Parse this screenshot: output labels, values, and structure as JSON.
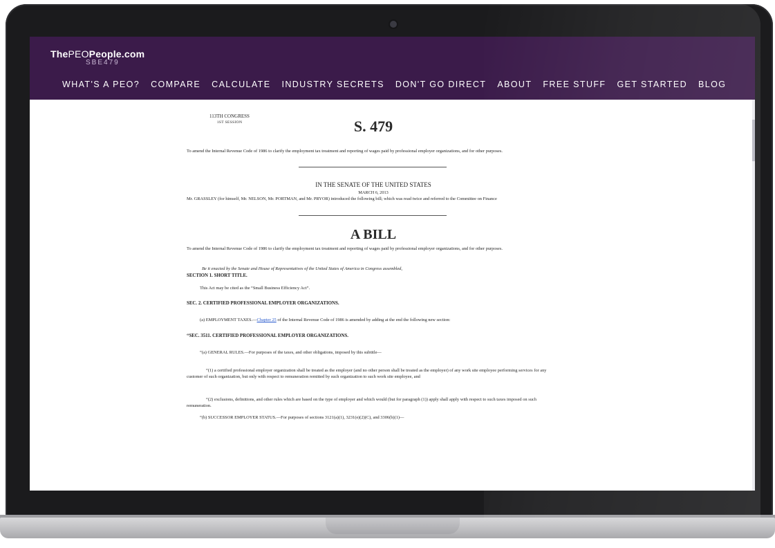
{
  "site": {
    "logo_the": "The",
    "logo_peo": "PEO",
    "logo_people": "People",
    "logo_domain": ".com",
    "logo_sub": "SBE479"
  },
  "nav": {
    "items": [
      "WHAT'S A PEO?",
      "COMPARE",
      "CALCULATE",
      "INDUSTRY SECRETS",
      "DON'T GO DIRECT",
      "ABOUT",
      "FREE STUFF",
      "GET STARTED",
      "BLOG"
    ]
  },
  "doc": {
    "congress": "113TH CONGRESS",
    "session": "1ST SESSION",
    "bill_number": "S. 479",
    "purpose1": "To amend the Internal Revenue Code of 1986 to clarify the employment tax treatment and reporting of wages paid by professional employer organizations, and for other purposes.",
    "senate": "IN THE SENATE OF THE UNITED STATES",
    "date": "MARCH 6, 2013",
    "intro": "Mr. GRASSLEY (for himself, Mr. NELSON, Mr. PORTMAN, and Mr. PRYOR) introduced the following bill; which was read twice and referred to the Committee on Finance",
    "a_bill": "A BILL",
    "purpose2": "To amend the Internal Revenue Code of 1986 to clarify the employment tax treatment and reporting of wages paid by professional employer organizations, and for other purposes.",
    "enact": "Be it enacted by the Senate and House of Representatives of the United States of America in Congress assembled,",
    "sec1_heading": "SECTION 1. SHORT TITLE.",
    "sec1_text": "This Act may be cited as the “Small Business Efficiency Act”.",
    "sec2_heading": "SEC. 2. CERTIFIED PROFESSIONAL EMPLOYER ORGANIZATIONS.",
    "sec2_a_prefix": "(a) EMPLOYMENT TAXES.—",
    "sec2_a_link": "Chapter 25",
    "sec2_a_suffix": " of the Internal Revenue Code of 1986 is amended by adding at the end the following new section:",
    "sec3511_heading": "“SEC. 3511. CERTIFIED PROFESSIONAL EMPLOYER ORGANIZATIONS.",
    "rules_a": "“(a) GENERAL RULES.—For purposes of the taxes, and other obligations, imposed by this subtitle—",
    "rules_a1": "“(1) a certified professional employer organization shall be treated as the employer (and no other person shall be treated as the employer) of any work site employee performing services for any customer of such organization, but only with respect to remuneration remitted by such organization to such work site employee, and",
    "rules_a2": "“(2) exclusions, definitions, and other rules which are based on the type of employer and which would (but for paragraph (1)) apply shall apply with respect to such taxes imposed on such remuneration.",
    "rules_b": "“(b) SUCCESSOR EMPLOYER STATUS.—For purposes of sections 3121(a)(1), 3231(e)(2)(C), and 3306(b)(1)—"
  }
}
